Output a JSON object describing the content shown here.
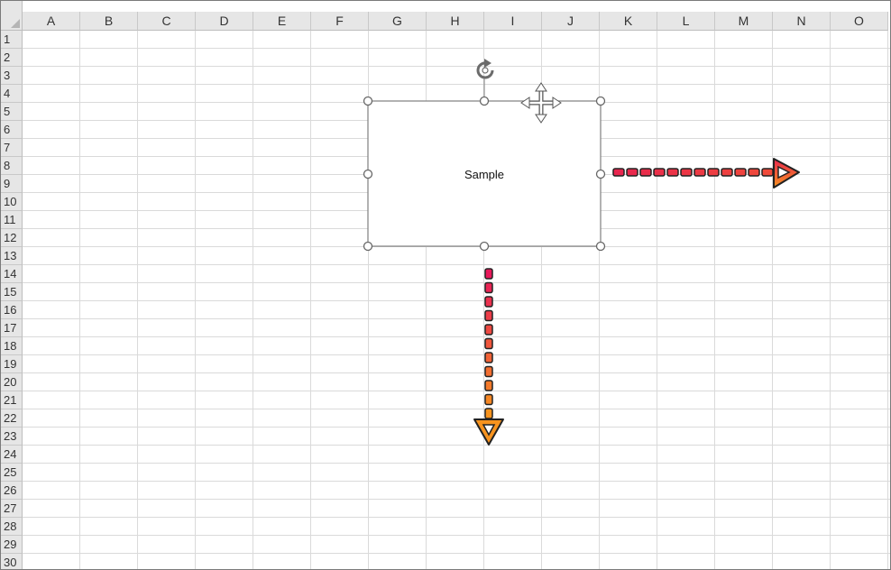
{
  "columns": [
    "A",
    "B",
    "C",
    "D",
    "E",
    "F",
    "G",
    "H",
    "I",
    "J",
    "K",
    "L",
    "M",
    "N",
    "O"
  ],
  "rows": [
    "1",
    "2",
    "3",
    "4",
    "5",
    "6",
    "7",
    "8",
    "9",
    "10",
    "11",
    "12",
    "13",
    "14",
    "15",
    "16",
    "17",
    "18",
    "19",
    "20",
    "21",
    "22",
    "23",
    "24",
    "25",
    "26",
    "27",
    "28",
    "29",
    "30"
  ],
  "shape": {
    "text": "Sample"
  },
  "colors": {
    "arrow_red": "#e8264f",
    "arrow_orange": "#f7931e",
    "shape_border": "#7f7f7f",
    "gridline": "#dadada",
    "header_bg": "#e6e6e6"
  },
  "icons": {
    "rotate": "rotate-handle-icon",
    "move": "move-cursor-icon"
  }
}
